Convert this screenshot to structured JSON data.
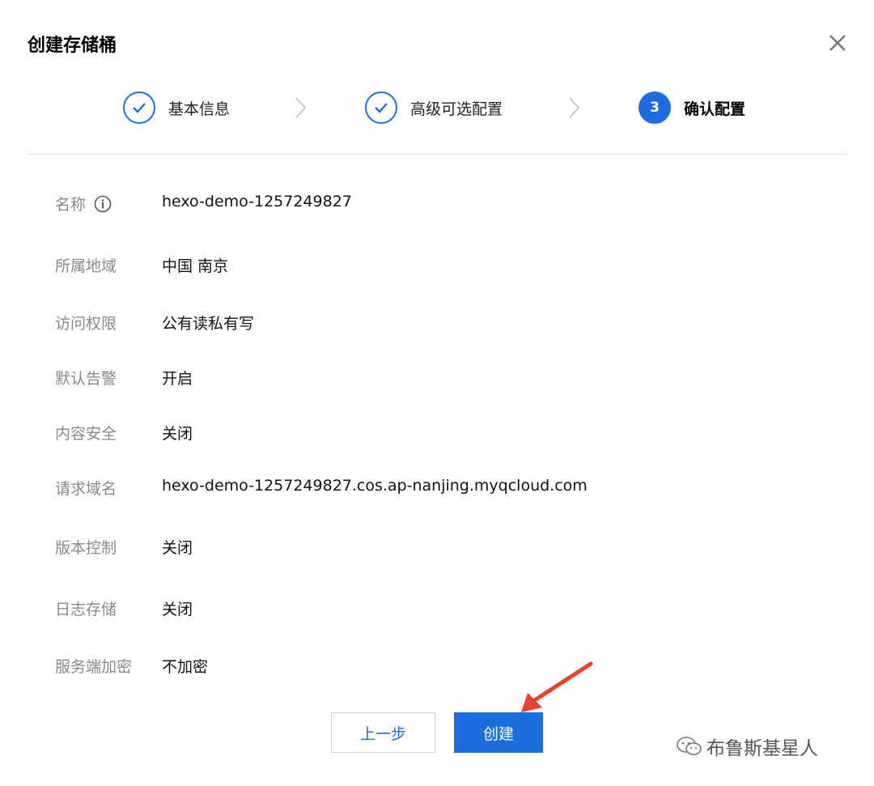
{
  "dialog": {
    "title": "创建存储桶",
    "steps": [
      {
        "label": "基本信息",
        "state": "done"
      },
      {
        "label": "高级可选配置",
        "state": "done"
      },
      {
        "label": "确认配置",
        "state": "current",
        "number": "3"
      }
    ],
    "fields": [
      {
        "key": "名称",
        "value": "hexo-demo-1257249827",
        "has_info_icon": true
      },
      {
        "key": "所属地域",
        "value": "中国 南京"
      },
      {
        "key": "访问权限",
        "value": "公有读私有写"
      },
      {
        "key": "默认告警",
        "value": "开启"
      },
      {
        "key": "内容安全",
        "value": "关闭"
      },
      {
        "key": "请求域名",
        "value": "hexo-demo-1257249827.cos.ap-nanjing.myqcloud.com"
      },
      {
        "key": "版本控制",
        "value": "关闭"
      },
      {
        "key": "日志存储",
        "value": "关闭"
      },
      {
        "key": "服务端加密",
        "value": "不加密"
      }
    ],
    "buttons": {
      "prev_label": "上一步",
      "create_label": "创建"
    }
  },
  "watermark": {
    "text": "布鲁斯基星人",
    "icon": "wechat-icon"
  },
  "colors": {
    "accent": "#1e6ddf",
    "arrow": "#e8432f"
  }
}
